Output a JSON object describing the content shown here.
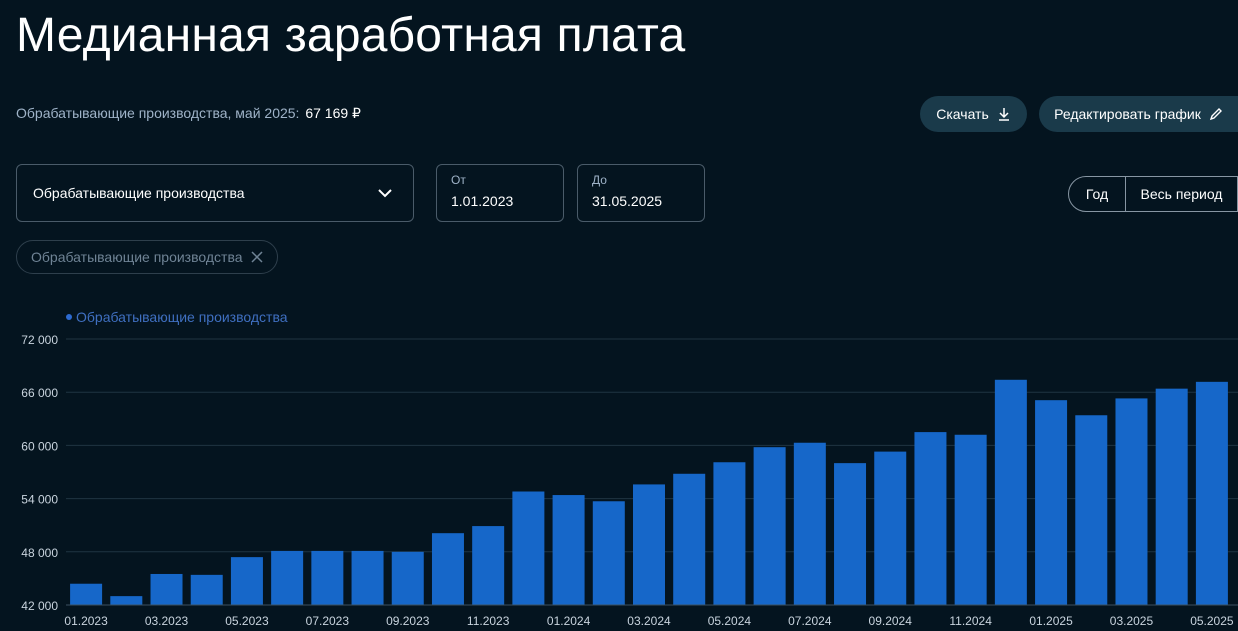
{
  "header": {
    "title": "Медианная заработная плата",
    "subtitle_label": "Обрабатывающие производства, май 2025:",
    "subtitle_value": "67 169 ₽"
  },
  "toolbar": {
    "download_label": "Скачать",
    "edit_label": "Редактировать график"
  },
  "filters": {
    "industry_select": "Обрабатывающие производства",
    "from_label": "От",
    "from_value": "1.01.2023",
    "to_label": "До",
    "to_value": "31.05.2025",
    "period_year": "Год",
    "period_all": "Весь период",
    "chip_label": "Обрабатывающие производства"
  },
  "colors": {
    "bar": "#1667c9",
    "background": "#04141f",
    "grid": "#1f3442",
    "accent_pill": "#1a3a4a"
  },
  "chart_data": {
    "type": "bar",
    "legend": [
      "Обрабатывающие производства"
    ],
    "ylim": [
      42000,
      72000
    ],
    "yticks": [
      "42 000",
      "48 000",
      "54 000",
      "60 000",
      "66 000",
      "72 000"
    ],
    "ytick_values": [
      42000,
      48000,
      54000,
      60000,
      66000,
      72000
    ],
    "categories": [
      "01.2023",
      "02.2023",
      "03.2023",
      "04.2023",
      "05.2023",
      "06.2023",
      "07.2023",
      "08.2023",
      "09.2023",
      "10.2023",
      "11.2023",
      "12.2023",
      "01.2024",
      "02.2024",
      "03.2024",
      "04.2024",
      "05.2024",
      "06.2024",
      "07.2024",
      "08.2024",
      "09.2024",
      "10.2024",
      "11.2024",
      "12.2024",
      "01.2025",
      "02.2025",
      "03.2025",
      "04.2025",
      "05.2025"
    ],
    "xtick_labels": [
      "01.2023",
      "03.2023",
      "05.2023",
      "07.2023",
      "09.2023",
      "11.2023",
      "01.2024",
      "03.2024",
      "05.2024",
      "07.2024",
      "09.2024",
      "11.2024",
      "01.2025",
      "03.2025",
      "05.2025"
    ],
    "series": [
      {
        "name": "Обрабатывающие производства",
        "values": [
          44400,
          43000,
          45500,
          45400,
          47400,
          48100,
          48100,
          48100,
          48000,
          50100,
          50900,
          54800,
          54400,
          53700,
          55600,
          56800,
          58100,
          59800,
          60300,
          58000,
          59300,
          61500,
          61200,
          67400,
          65100,
          63400,
          65300,
          66400,
          67169
        ]
      }
    ],
    "grid": true
  }
}
